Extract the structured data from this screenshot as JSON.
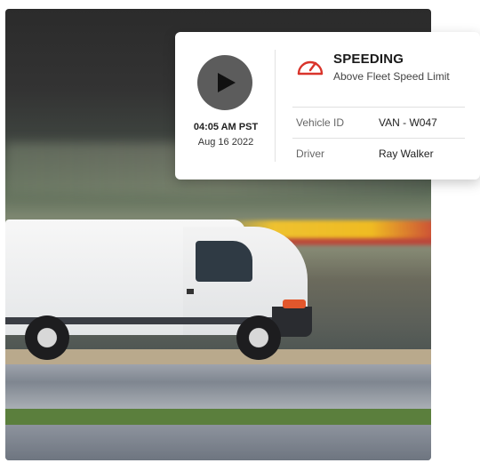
{
  "event": {
    "title": "SPEEDING",
    "subtitle": "Above Fleet Speed Limit",
    "time": "04:05 AM PST",
    "date": "Aug 16 2022",
    "icon": "speedometer-icon",
    "accent_color": "#d9342b"
  },
  "details": [
    {
      "label": "Vehicle ID",
      "value": "VAN - W047"
    },
    {
      "label": "Driver",
      "value": "Ray Walker"
    }
  ],
  "media": {
    "play_icon": "play-icon",
    "play_button_color": "#5c5c5c"
  }
}
